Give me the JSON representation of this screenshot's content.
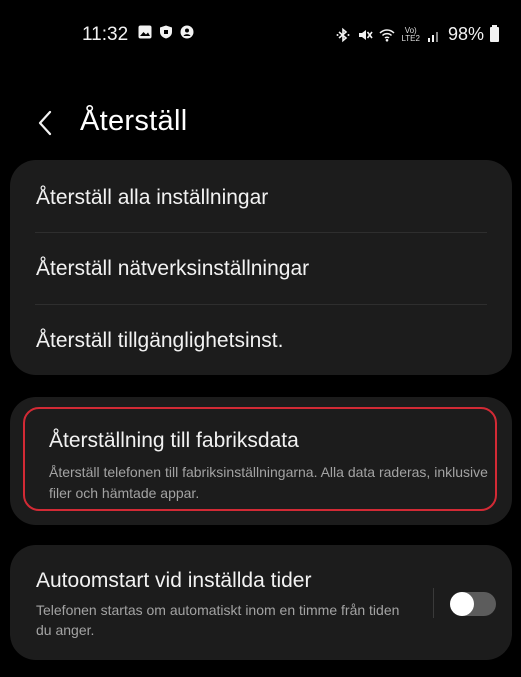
{
  "statusbar": {
    "time": "11:32",
    "left_icons": [
      "gallery-notification-icon",
      "shield-notification-icon",
      "account-notification-icon"
    ],
    "right_icons": [
      "bluetooth-icon",
      "mute-icon",
      "wifi-icon",
      "volte-lte2-icon",
      "signal-icon"
    ],
    "volte_top": "Vo)",
    "volte_bottom": "LTE2",
    "battery": "98%"
  },
  "header": {
    "title": "Återställ"
  },
  "reset_items": [
    {
      "label": "Återställ alla inställningar"
    },
    {
      "label": "Återställ nätverksinställningar"
    },
    {
      "label": "Återställ tillgänglighetsinst."
    }
  ],
  "factory_reset": {
    "title": "Återställning till fabriksdata",
    "description": "Återställ telefonen till fabriksinställningarna. Alla data raderas, inklusive filer och hämtade appar.",
    "highlight_color": "#d22a35"
  },
  "auto_restart": {
    "title": "Autoomstart vid inställda tider",
    "description": "Telefonen startas om automatiskt inom en timme från tiden du anger.",
    "enabled": false
  }
}
